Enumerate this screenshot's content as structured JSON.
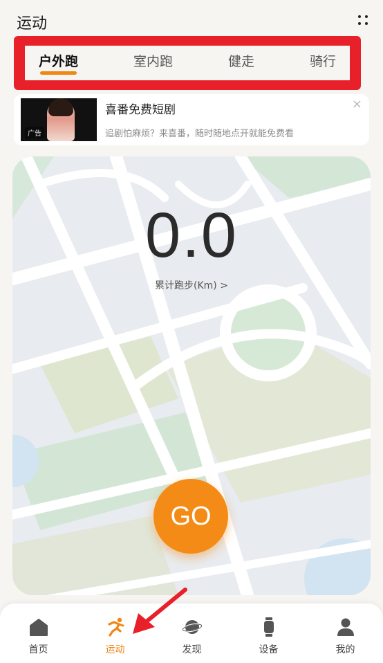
{
  "header": {
    "title": "运动"
  },
  "tabs": [
    {
      "label": "户外跑",
      "active": true
    },
    {
      "label": "室内跑",
      "active": false
    },
    {
      "label": "健走",
      "active": false
    },
    {
      "label": "骑行",
      "active": false
    }
  ],
  "ad": {
    "title": "喜番免费短剧",
    "description": "追剧怕麻烦？来喜番，随时随地点开就能免费看",
    "tag": "广告",
    "close": "×"
  },
  "main": {
    "distance_value": "0.0",
    "distance_label": "累计跑步(Km) >",
    "go_label": "GO"
  },
  "bottom_nav": [
    {
      "label": "首页",
      "icon": "home-icon",
      "active": false
    },
    {
      "label": "运动",
      "icon": "running-icon",
      "active": true
    },
    {
      "label": "发现",
      "icon": "planet-icon",
      "active": false
    },
    {
      "label": "设备",
      "icon": "watch-icon",
      "active": false
    },
    {
      "label": "我的",
      "icon": "person-icon",
      "active": false
    }
  ],
  "colors": {
    "accent": "#f08613",
    "highlight_box": "#e8202a",
    "map_park": "#d4e6d6",
    "map_field": "#e3e7d6",
    "map_water": "#cfe2f0"
  }
}
